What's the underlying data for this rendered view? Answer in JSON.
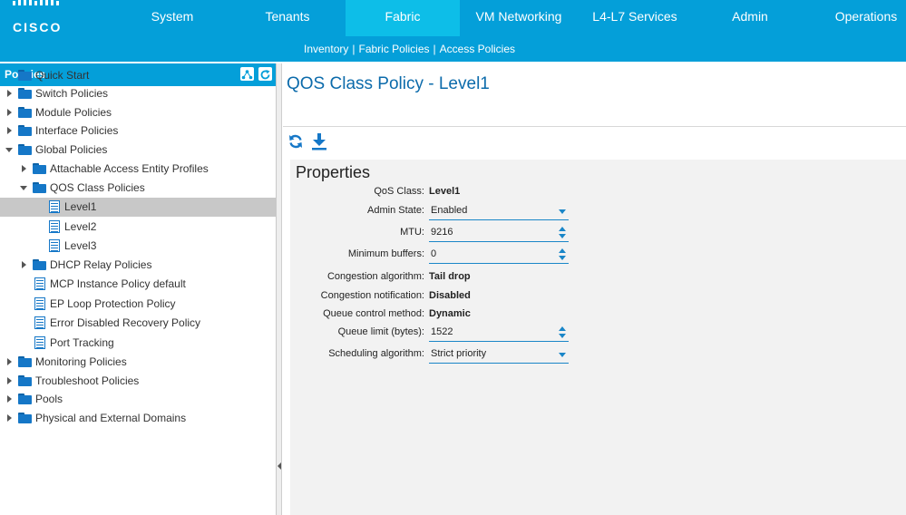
{
  "brand": {
    "logo_text": "cisco",
    "accent_color": "#049fd9",
    "active_tab_color": "#0dbee8",
    "link_color": "#0c6bab"
  },
  "nav": {
    "tabs": [
      {
        "label": "System"
      },
      {
        "label": "Tenants"
      },
      {
        "label": "Fabric",
        "active": true
      },
      {
        "label": "VM Networking"
      },
      {
        "label": "L4-L7 Services"
      },
      {
        "label": "Admin"
      },
      {
        "label": "Operations"
      }
    ],
    "subnav": [
      {
        "label": "Inventory"
      },
      {
        "label": "Fabric Policies"
      },
      {
        "label": "Access Policies",
        "active": true
      }
    ],
    "separator": "|"
  },
  "sidebar": {
    "title": "Policies",
    "header_icons": [
      "network-icon",
      "refresh-icon"
    ],
    "tree": [
      {
        "label": "Quick Start",
        "icon": "folder-icon",
        "expander": "none",
        "depth": 0
      },
      {
        "label": "Switch Policies",
        "icon": "folder-icon",
        "expander": "collapsed",
        "depth": 0
      },
      {
        "label": "Module Policies",
        "icon": "folder-icon",
        "expander": "collapsed",
        "depth": 0
      },
      {
        "label": "Interface Policies",
        "icon": "folder-icon",
        "expander": "collapsed",
        "depth": 0
      },
      {
        "label": "Global Policies",
        "icon": "folder-icon",
        "expander": "expanded",
        "depth": 0
      },
      {
        "label": "Attachable Access Entity Profiles",
        "icon": "folder-icon",
        "expander": "collapsed",
        "depth": 1
      },
      {
        "label": "QOS Class Policies",
        "icon": "folder-icon",
        "expander": "expanded",
        "depth": 1
      },
      {
        "label": "Level1",
        "icon": "policy-doc-icon",
        "expander": "none",
        "depth": 2,
        "selected": true
      },
      {
        "label": "Level2",
        "icon": "policy-doc-icon",
        "expander": "none",
        "depth": 2
      },
      {
        "label": "Level3",
        "icon": "policy-doc-icon",
        "expander": "none",
        "depth": 2
      },
      {
        "label": "DHCP Relay Policies",
        "icon": "folder-icon",
        "expander": "collapsed",
        "depth": 1
      },
      {
        "label": "MCP Instance Policy default",
        "icon": "policy-doc-icon",
        "expander": "none",
        "depth": 1
      },
      {
        "label": "EP Loop Protection Policy",
        "icon": "policy-doc-icon",
        "expander": "none",
        "depth": 1
      },
      {
        "label": "Error Disabled Recovery Policy",
        "icon": "policy-doc-icon",
        "expander": "none",
        "depth": 1
      },
      {
        "label": "Port Tracking",
        "icon": "policy-doc-icon",
        "expander": "none",
        "depth": 1
      },
      {
        "label": "Monitoring Policies",
        "icon": "folder-icon",
        "expander": "collapsed",
        "depth": 0
      },
      {
        "label": "Troubleshoot Policies",
        "icon": "folder-icon",
        "expander": "collapsed",
        "depth": 0
      },
      {
        "label": "Pools",
        "icon": "folder-icon",
        "expander": "collapsed",
        "depth": 0
      },
      {
        "label": "Physical and External Domains",
        "icon": "folder-icon",
        "expander": "collapsed",
        "depth": 0
      }
    ]
  },
  "main": {
    "title": "QOS Class Policy - Level1",
    "toolbar_icons": [
      "refresh-icon",
      "download-icon"
    ],
    "properties": {
      "heading": "Properties",
      "rows": [
        {
          "label": "QoS Class:",
          "value": "Level1",
          "kind": "text"
        },
        {
          "label": "Admin State:",
          "value": "Enabled",
          "kind": "select"
        },
        {
          "label": "MTU:",
          "value": "9216",
          "kind": "spinner"
        },
        {
          "label": "Minimum buffers:",
          "value": "0",
          "kind": "spinner"
        },
        {
          "label": "Congestion algorithm:",
          "value": "Tail drop",
          "kind": "text"
        },
        {
          "label": "Congestion notification:",
          "value": "Disabled",
          "kind": "text"
        },
        {
          "label": "Queue control method:",
          "value": "Dynamic",
          "kind": "text"
        },
        {
          "label": "Queue limit (bytes):",
          "value": "1522",
          "kind": "spinner"
        },
        {
          "label": "Scheduling algorithm:",
          "value": "Strict priority",
          "kind": "select"
        }
      ]
    }
  }
}
